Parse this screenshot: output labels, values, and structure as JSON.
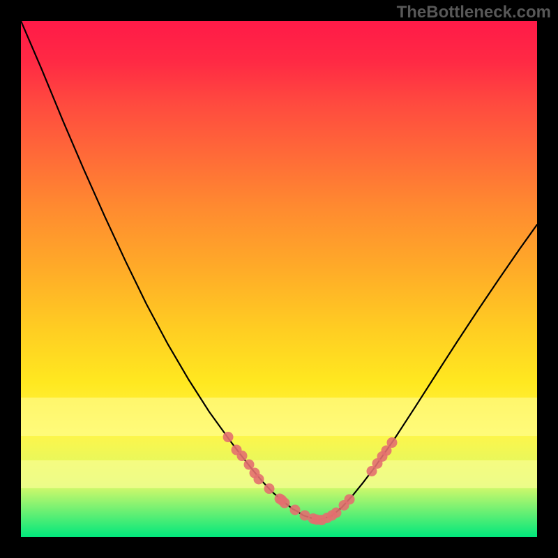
{
  "watermark": "TheBottleneck.com",
  "chart_data": {
    "type": "line",
    "title": "",
    "xlabel": "",
    "ylabel": "",
    "xlim": [
      0,
      100
    ],
    "ylim": [
      0,
      100
    ],
    "series": [
      {
        "name": "curve",
        "x": [
          0,
          4.05,
          8.11,
          12.16,
          16.22,
          20.27,
          24.32,
          28.38,
          32.43,
          36.49,
          40.54,
          42.57,
          44.59,
          46.62,
          48.65,
          50.68,
          52.7,
          53.38,
          54.73,
          57.43,
          60.14,
          62.16,
          64.19,
          66.22,
          68.24,
          72.3,
          76.35,
          80.41,
          84.46,
          88.51,
          92.57,
          96.62,
          100
        ],
        "values": [
          100,
          90.57,
          80.72,
          71.28,
          62.17,
          53.45,
          45.14,
          37.53,
          30.61,
          24.26,
          18.65,
          15.95,
          13.38,
          10.95,
          8.78,
          7.03,
          5.41,
          5.07,
          4.19,
          3.31,
          4.05,
          5.74,
          7.97,
          10.47,
          13.11,
          18.92,
          25.14,
          31.49,
          37.77,
          43.92,
          49.93,
          55.81,
          60.54
        ]
      }
    ],
    "markers": {
      "name": "highlighted-points",
      "color": "#e36f6f",
      "points": [
        {
          "x": 40.14,
          "y": 19.39
        },
        {
          "x": 41.76,
          "y": 16.89
        },
        {
          "x": 42.84,
          "y": 15.74
        },
        {
          "x": 44.19,
          "y": 14.05
        },
        {
          "x": 45.27,
          "y": 12.43
        },
        {
          "x": 46.08,
          "y": 11.22
        },
        {
          "x": 48.11,
          "y": 9.39
        },
        {
          "x": 50.14,
          "y": 7.43
        },
        {
          "x": 50.54,
          "y": 7.16
        },
        {
          "x": 51.08,
          "y": 6.62
        },
        {
          "x": 53.11,
          "y": 5.27
        },
        {
          "x": 55.0,
          "y": 4.19
        },
        {
          "x": 56.62,
          "y": 3.58
        },
        {
          "x": 57.3,
          "y": 3.38
        },
        {
          "x": 58.24,
          "y": 3.31
        },
        {
          "x": 59.32,
          "y": 3.72
        },
        {
          "x": 60.27,
          "y": 4.19
        },
        {
          "x": 61.08,
          "y": 4.73
        },
        {
          "x": 62.57,
          "y": 6.15
        },
        {
          "x": 63.65,
          "y": 7.3
        },
        {
          "x": 67.97,
          "y": 12.77
        },
        {
          "x": 69.05,
          "y": 14.26
        },
        {
          "x": 70.0,
          "y": 15.61
        },
        {
          "x": 70.81,
          "y": 16.76
        },
        {
          "x": 71.89,
          "y": 18.31
        }
      ]
    },
    "bands": [
      {
        "top_pct": 72.97,
        "height_pct": 7.43
      },
      {
        "top_pct": 85.14,
        "height_pct": 5.41
      }
    ]
  }
}
